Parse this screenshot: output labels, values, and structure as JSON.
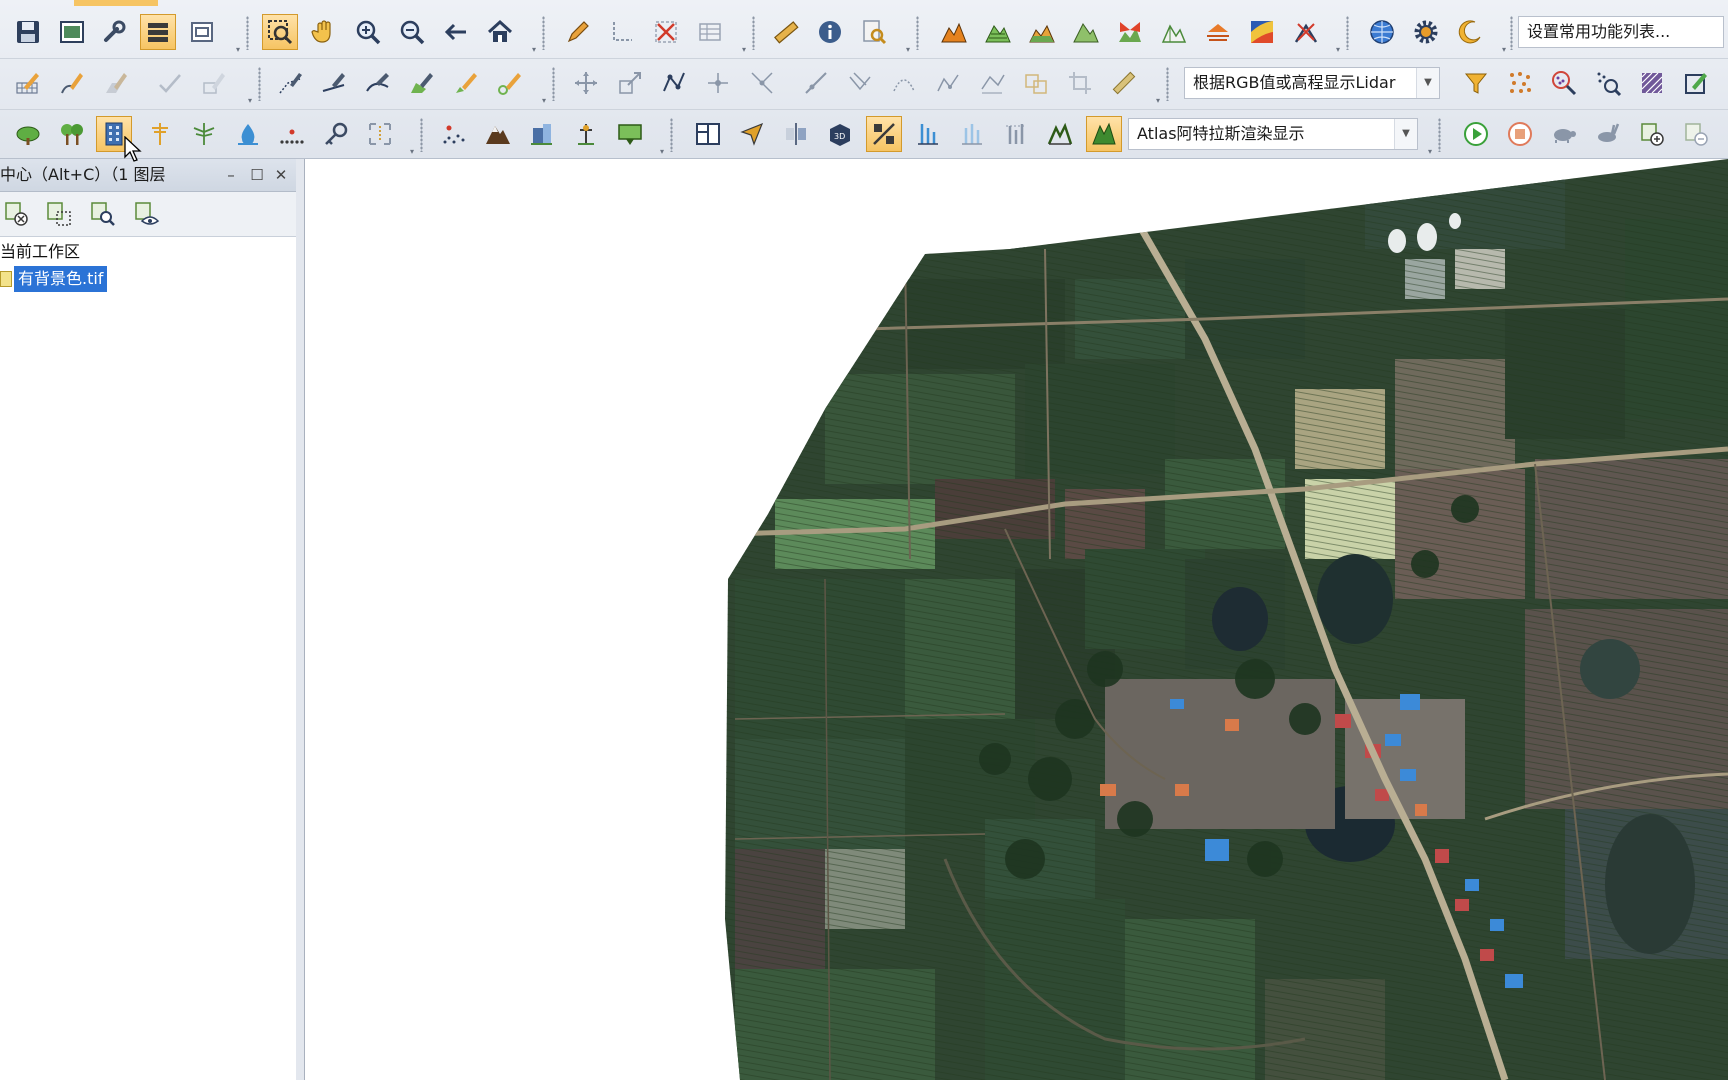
{
  "toolbar": {
    "combo_common_functions": "设置常用功能列表...",
    "combo_lidar_display": "根据RGB值或高程显示Lidar",
    "combo_atlas_render": "Atlas阿特拉斯渲染显示",
    "icons_row1": [
      "save-icon",
      "layout-icon",
      "wrench-icon",
      "layers-panel-icon",
      "window-icon",
      "select-zoom-icon",
      "pan-hand-icon",
      "zoom-in-icon",
      "zoom-out-icon",
      "back-arrow-icon",
      "home-icon",
      "pencil-icon",
      "select-vertex-icon",
      "delete-feature-icon",
      "attribute-table-icon",
      "ruler-icon",
      "info-icon",
      "find-icon",
      "terrain-1-icon",
      "terrain-2-icon",
      "terrain-3-icon",
      "terrain-4-icon",
      "terrain-5-icon",
      "terrain-6-icon",
      "terrain-7-icon",
      "terrain-8-icon",
      "terrain-9-icon",
      "globe-icon",
      "gear-icon",
      "moon-icon"
    ],
    "icons_row3": [
      "tree-1-icon",
      "tree-2-icon",
      "building-icon",
      "pole-icon",
      "antenna-icon",
      "water-drop-icon",
      "points-icon",
      "key-icon",
      "scale-icon",
      "scatter-icon",
      "mountain-icon",
      "building-3d-icon",
      "marker-icon",
      "map-frame-icon",
      "split-view-icon",
      "arrow-fly-icon",
      "compare-icon",
      "3d-box-icon",
      "percent-icon",
      "height-1-icon",
      "height-2-icon",
      "height-3-icon",
      "peak-1-icon",
      "peak-2-icon",
      "play-icon",
      "stop-icon",
      "turtle-icon",
      "rabbit-icon",
      "add-layer-icon",
      "remove-layer-icon"
    ]
  },
  "panel": {
    "title": "中心（Alt+C）（1 图层",
    "tree_root": "当前工作区",
    "layer_name": "有背景色.tif"
  },
  "colors": {
    "toolbar_bg": "#e6eaf0",
    "active_button": "#f6c463",
    "selection": "#2b73d6",
    "map_bg": "#ffffff",
    "field_dark": "#2f4531",
    "field_mid": "#3b5a3c",
    "road": "#b9ae93"
  }
}
